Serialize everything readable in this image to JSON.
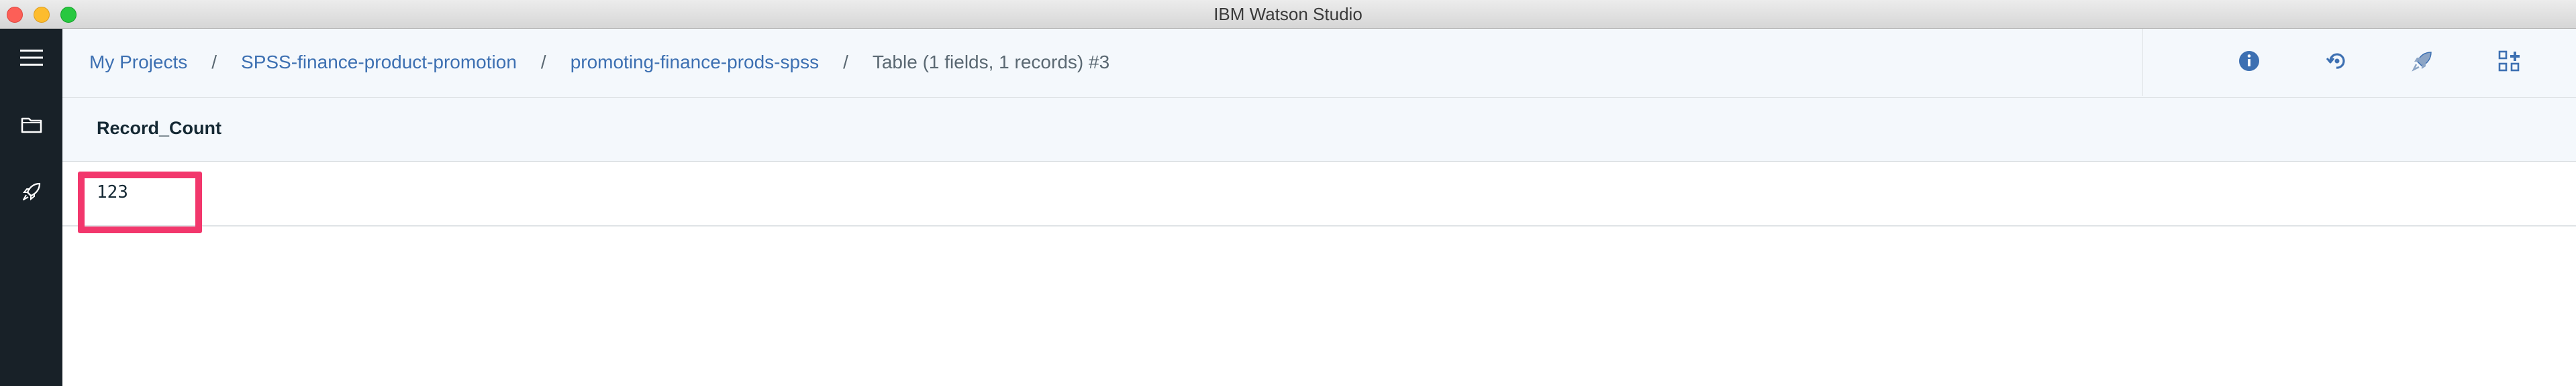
{
  "window": {
    "title": "IBM Watson Studio"
  },
  "rail": {
    "items": [
      {
        "icon": "hamburger-menu-icon"
      },
      {
        "icon": "folder-icon"
      },
      {
        "icon": "rocket-icon"
      }
    ]
  },
  "breadcrumb": {
    "items": [
      {
        "label": "My Projects"
      },
      {
        "label": "SPSS-finance-product-promotion"
      },
      {
        "label": "promoting-finance-prods-spss"
      }
    ],
    "separator": "/",
    "current": "Table (1 fields, 1 records) #3"
  },
  "toolbar": {
    "icons": [
      "info-icon",
      "refresh-icon",
      "deploy-icon",
      "grid-icon"
    ],
    "accent_color": "#3d70b2"
  },
  "table": {
    "columns": [
      "Record_Count"
    ],
    "rows": [
      [
        "123"
      ]
    ]
  },
  "colors": {
    "rail_bg": "#182128",
    "header_bg": "#f4f8fc",
    "link": "#3d70b2",
    "highlight": "#f2376c"
  }
}
